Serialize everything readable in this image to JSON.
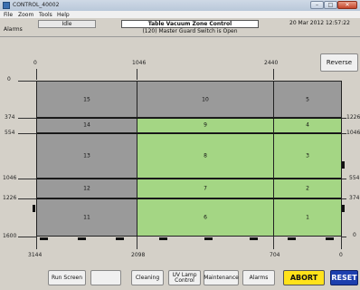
{
  "window": {
    "title": "CONTROL_40002",
    "min_glyph": "–",
    "max_glyph": "□",
    "close_glyph": "✕"
  },
  "menu": [
    "File",
    "Zoom",
    "Tools",
    "Help"
  ],
  "status": {
    "alarms_label": "Alarms",
    "state": "Idle",
    "title": "Table Vacuum Zone Control",
    "datetime": "20 Mar 2012 12:57:22",
    "alarm_message": "(120) Master Guard Switch is Open"
  },
  "reverse_label": "Reverse",
  "axes": {
    "top": [
      "0",
      "1046",
      "2440"
    ],
    "bottom": [
      "3144",
      "2098",
      "704",
      "0"
    ],
    "left": [
      "0",
      "374",
      "554",
      "1046",
      "1226",
      "1600"
    ],
    "right": [
      "1226",
      "1046",
      "554",
      "374",
      "0"
    ]
  },
  "zone_colors": {
    "inactive": "#9a9a9a",
    "active": "#a4d684"
  },
  "zones": [
    {
      "label": "15",
      "active": false
    },
    {
      "label": "10",
      "active": false
    },
    {
      "label": "5",
      "active": false
    },
    {
      "label": "14",
      "active": false
    },
    {
      "label": "9",
      "active": true
    },
    {
      "label": "4",
      "active": true
    },
    {
      "label": "13",
      "active": false
    },
    {
      "label": "8",
      "active": true
    },
    {
      "label": "3",
      "active": true
    },
    {
      "label": "12",
      "active": false
    },
    {
      "label": "7",
      "active": true
    },
    {
      "label": "2",
      "active": true
    },
    {
      "label": "11",
      "active": false
    },
    {
      "label": "6",
      "active": true
    },
    {
      "label": "1",
      "active": true
    }
  ],
  "buttons": {
    "run_screen": "Run Screen",
    "blank": "",
    "cleaning": "Cleaning",
    "uv_lamp_control": "UV Lamp\nControl",
    "maintenance": "Maintenance",
    "alarms": "Alarms",
    "abort": "ABORT",
    "reset": "RESET"
  }
}
